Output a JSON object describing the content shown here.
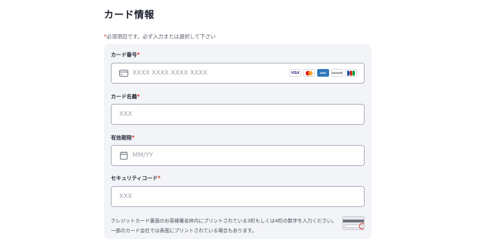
{
  "page": {
    "title": "カード情報"
  },
  "required_note": {
    "mark": "*",
    "text": "必須項目です。必ず入力または選択して下さい"
  },
  "fields": {
    "card_number": {
      "label": "カード番号",
      "required_mark": "*",
      "placeholder": "XXXX XXXX XXXX XXXX",
      "value": "",
      "icon": "credit-card-icon"
    },
    "card_holder": {
      "label": "カード名義",
      "required_mark": "*",
      "placeholder": "XXX",
      "value": ""
    },
    "expiry": {
      "label": "有効期限",
      "required_mark": "*",
      "placeholder": "MM/YY",
      "value": "",
      "icon": "calendar-icon"
    },
    "security_code": {
      "label": "セキュリティコード",
      "required_mark": "*",
      "placeholder": "XXX",
      "value": ""
    }
  },
  "brands": [
    {
      "name": "visa-logo",
      "text": "VISA"
    },
    {
      "name": "mastercard-logo",
      "text": ""
    },
    {
      "name": "amex-logo",
      "text": "AMEX"
    },
    {
      "name": "discover-logo",
      "text": "DISCOVER"
    },
    {
      "name": "jcb-logo",
      "text": "JCB"
    }
  ],
  "help": {
    "line1": "クレジットカード裏面のお客様署名枠内にプリントされている3桁もしくは4桁の数字を入力ください。",
    "line2": "一部のカード会社では表面にプリントされている場合もあります。"
  },
  "colors": {
    "required": "#e0302a",
    "panel_bg": "#f3f4f8",
    "input_border": "#a7abb6",
    "amex": "#2e77bc",
    "visa": "#1a1f71"
  }
}
